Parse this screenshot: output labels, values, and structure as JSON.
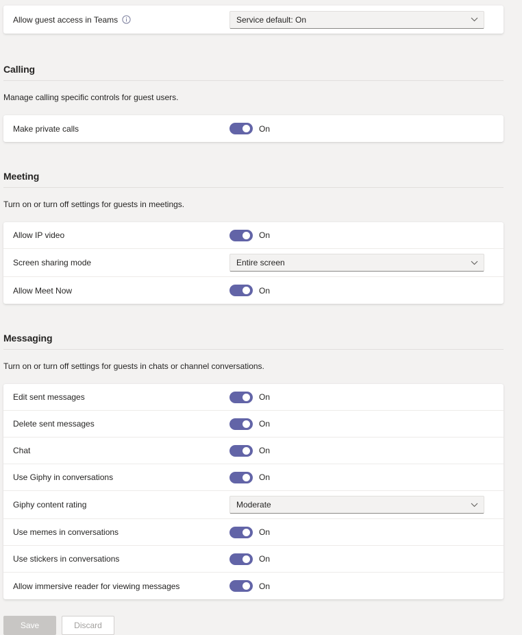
{
  "top_card": {
    "rows": [
      {
        "label": "Allow guest access in Teams",
        "info_icon": "info-icon",
        "control": "dropdown",
        "value": "Service default: On"
      }
    ]
  },
  "sections": [
    {
      "title": "Calling",
      "description": "Manage calling specific controls for guest users.",
      "rows": [
        {
          "label": "Make private calls",
          "control": "toggle",
          "state": "On"
        }
      ]
    },
    {
      "title": "Meeting",
      "description": "Turn on or turn off settings for guests in meetings.",
      "rows": [
        {
          "label": "Allow IP video",
          "control": "toggle",
          "state": "On"
        },
        {
          "label": "Screen sharing mode",
          "control": "dropdown",
          "value": "Entire screen"
        },
        {
          "label": "Allow Meet Now",
          "control": "toggle",
          "state": "On"
        }
      ]
    },
    {
      "title": "Messaging",
      "description": "Turn on or turn off settings for guests in chats or channel conversations.",
      "rows": [
        {
          "label": "Edit sent messages",
          "control": "toggle",
          "state": "On"
        },
        {
          "label": "Delete sent messages",
          "control": "toggle",
          "state": "On"
        },
        {
          "label": "Chat",
          "control": "toggle",
          "state": "On"
        },
        {
          "label": "Use Giphy in conversations",
          "control": "toggle",
          "state": "On"
        },
        {
          "label": "Giphy content rating",
          "control": "dropdown",
          "value": "Moderate"
        },
        {
          "label": "Use memes in conversations",
          "control": "toggle",
          "state": "On"
        },
        {
          "label": "Use stickers in conversations",
          "control": "toggle",
          "state": "On"
        },
        {
          "label": "Allow immersive reader for viewing messages",
          "control": "toggle",
          "state": "On"
        }
      ]
    }
  ],
  "footer": {
    "save_label": "Save",
    "discard_label": "Discard"
  },
  "colors": {
    "accent": "#6264a7",
    "page_bg": "#f3f2f1",
    "card_bg": "#ffffff",
    "divider": "#edebe9",
    "disabled_button": "#c8c6c4"
  }
}
